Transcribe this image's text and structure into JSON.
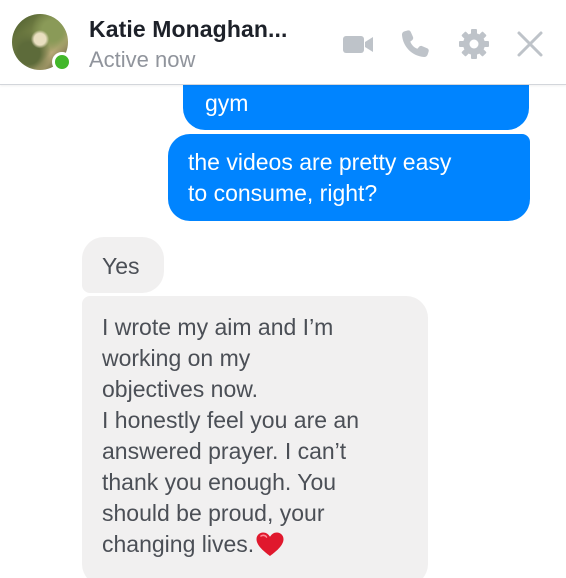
{
  "header": {
    "contact_name": "Katie Monaghan...",
    "status": "Active now",
    "icons": {
      "video": "video-camera-icon",
      "call": "phone-icon",
      "settings": "gear-icon",
      "close": "close-icon"
    }
  },
  "messages": [
    {
      "direction": "outgoing",
      "text": "gym"
    },
    {
      "direction": "outgoing",
      "text": "the videos are pretty easy\nto consume, right?"
    },
    {
      "direction": "incoming",
      "text": "Yes"
    },
    {
      "direction": "incoming",
      "text": "I wrote my aim and I’m\nworking on my\nobjectives now.\nI honestly feel you are an\nanswered prayer. I can’t\nthank you enough. You\nshould be proud, your\nchanging lives."
    }
  ],
  "emoji": {
    "heart": "heart-icon"
  },
  "colors": {
    "outgoing_bubble": "#0084ff",
    "incoming_bubble": "#f1f0f0",
    "presence": "#42b72a",
    "header_icon": "#bec3c9"
  }
}
